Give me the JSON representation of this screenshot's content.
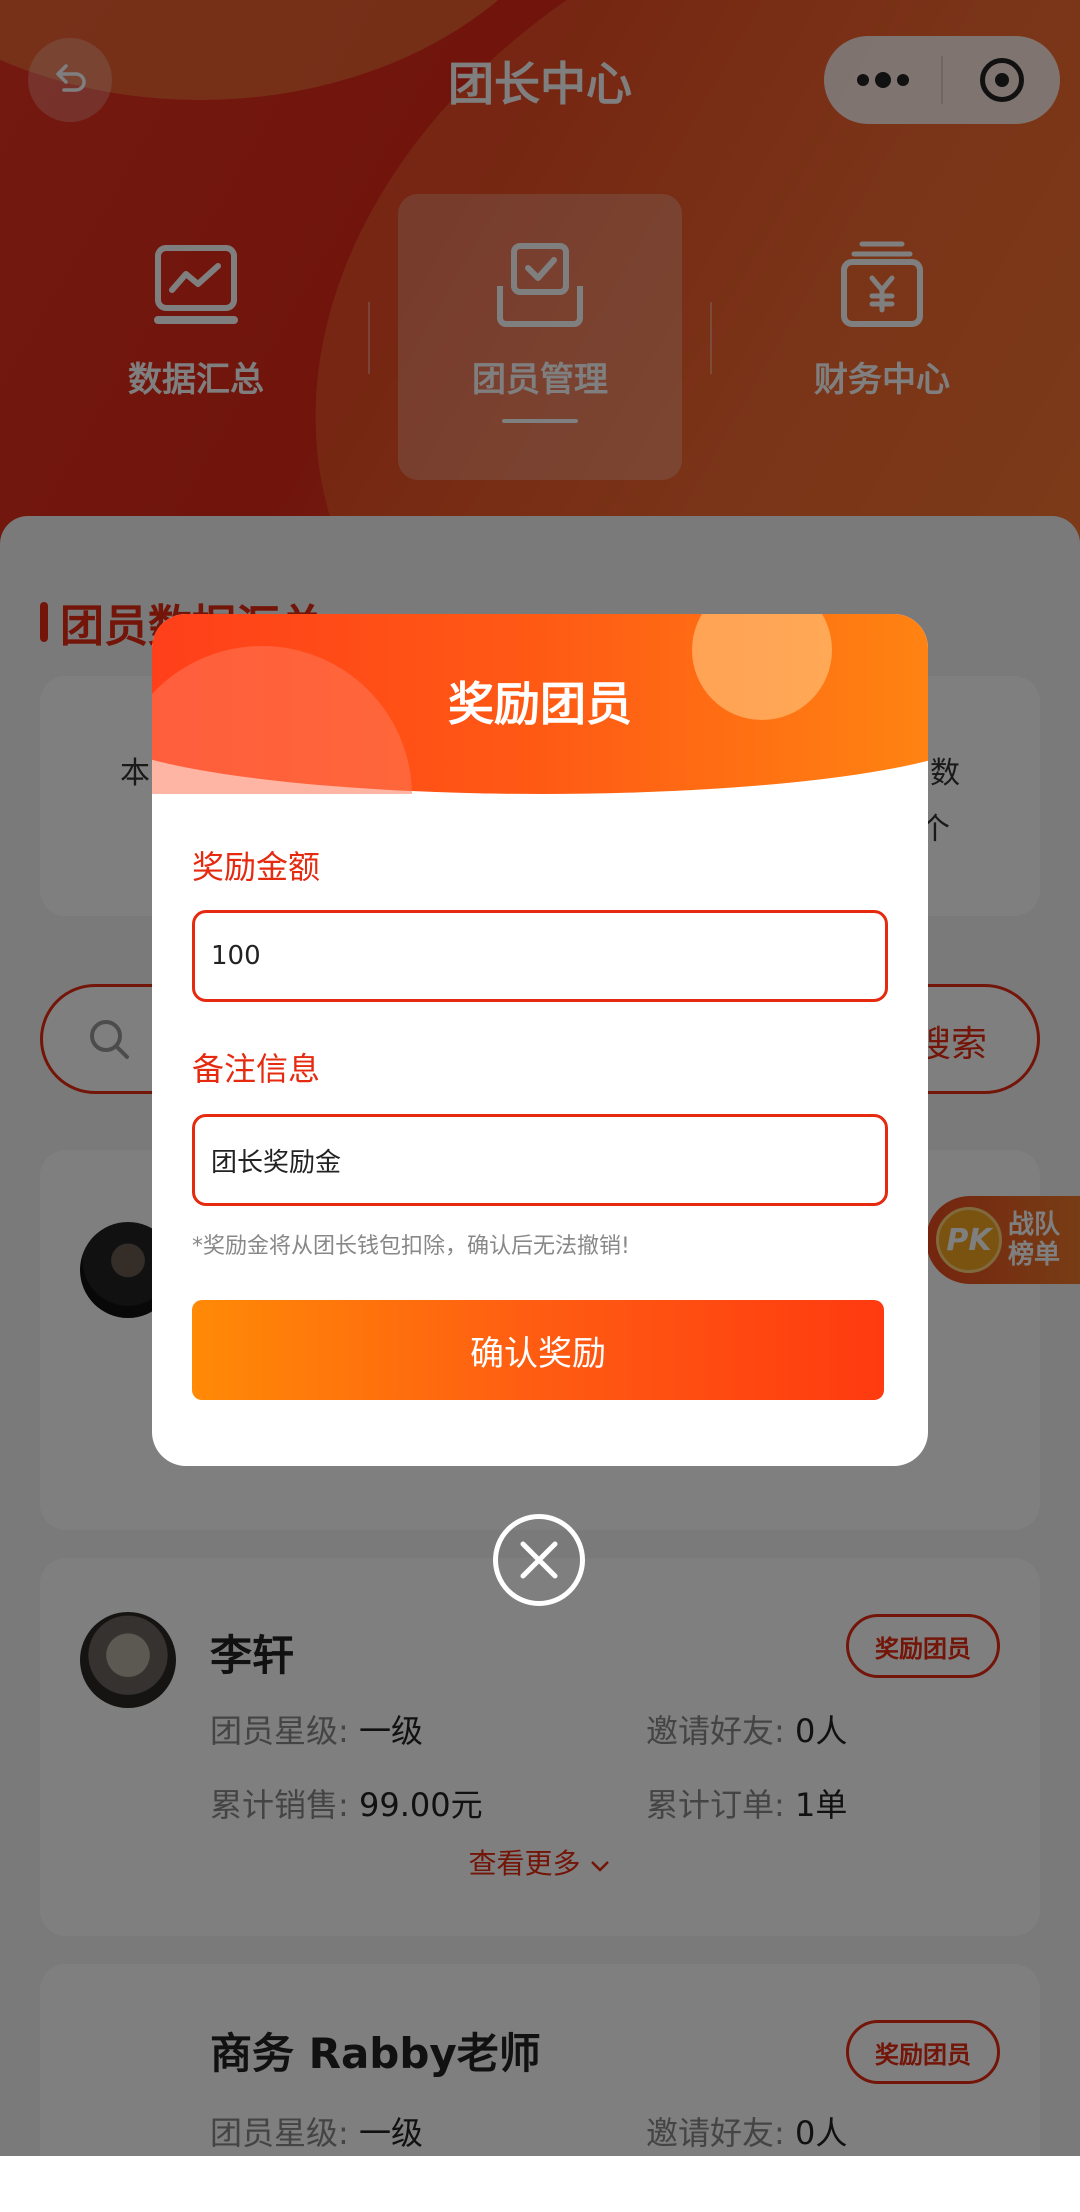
{
  "header": {
    "title": "团长中心",
    "tabs": [
      {
        "label": "数据汇总",
        "icon": "line-chart-icon"
      },
      {
        "label": "团员管理",
        "icon": "checkbox-tray-icon"
      },
      {
        "label": "财务中心",
        "icon": "yuan-wallet-icon"
      }
    ],
    "active_tab": 1
  },
  "summary": {
    "section_title": "团员数据汇总",
    "left_partial": "本",
    "right_partial": "数",
    "right_partial2": "个"
  },
  "search": {
    "button_label": "搜索"
  },
  "members": [
    {
      "name": "李轩",
      "reward_label": "奖励团员",
      "stats": [
        {
          "k": "团员星级:",
          "v": "一级"
        },
        {
          "k": "邀请好友:",
          "v": "0人"
        },
        {
          "k": "累计销售:",
          "v": "99.00元"
        },
        {
          "k": "累计订单:",
          "v": "1单"
        }
      ],
      "more_label": "查看更多"
    },
    {
      "name": "商务 Rabby老师",
      "reward_label": "奖励团员",
      "stats": [
        {
          "k": "团员星级:",
          "v": "一级"
        },
        {
          "k": "邀请好友:",
          "v": "0人"
        }
      ]
    }
  ],
  "pk_badge": {
    "icon_text": "PK",
    "line1": "战队",
    "line2": "榜单"
  },
  "modal": {
    "title": "奖励团员",
    "amount_label": "奖励金额",
    "amount_value": "100",
    "remark_label": "备注信息",
    "remark_value": "团长奖励金",
    "hint": "*奖励金将从团长钱包扣除，确认后无法撤销!",
    "confirm_label": "确认奖励"
  },
  "colors": {
    "accent": "#e62a10",
    "accent_orange": "#ff8a06",
    "overlay": "rgba(0,0,0,0.5)"
  }
}
